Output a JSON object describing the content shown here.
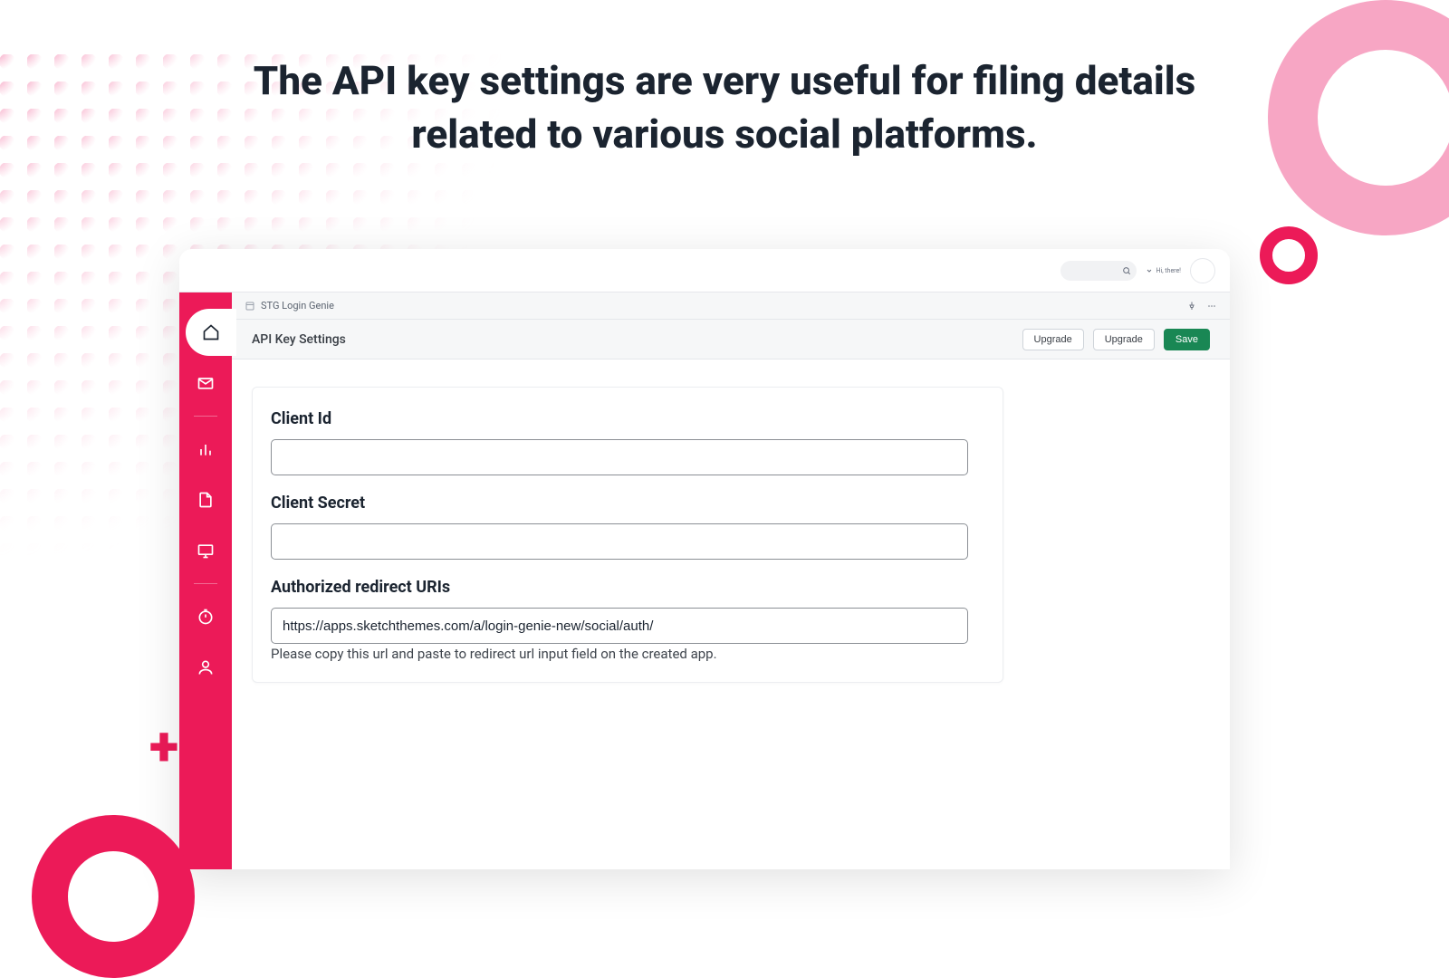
{
  "headline": "The API key settings are very useful for filing details related to various social platforms.",
  "breadcrumb": {
    "app_name": "STG Login Genie"
  },
  "page": {
    "title": "API Key Settings"
  },
  "header_actions": {
    "upgrade_inner": "Upgrade",
    "upgrade_outer": "Upgrade",
    "save": "Save"
  },
  "form": {
    "client_id": {
      "label": "Client Id",
      "value": ""
    },
    "client_secret": {
      "label": "Client Secret",
      "value": ""
    },
    "redirect": {
      "label": "Authorized redirect URIs",
      "value": "https://apps.sketchthemes.com/a/login-genie-new/social/auth/",
      "helper": "Please copy this url and paste to redirect url input field on the created app."
    }
  },
  "topbar": {
    "greeting": "Hi, there!"
  }
}
